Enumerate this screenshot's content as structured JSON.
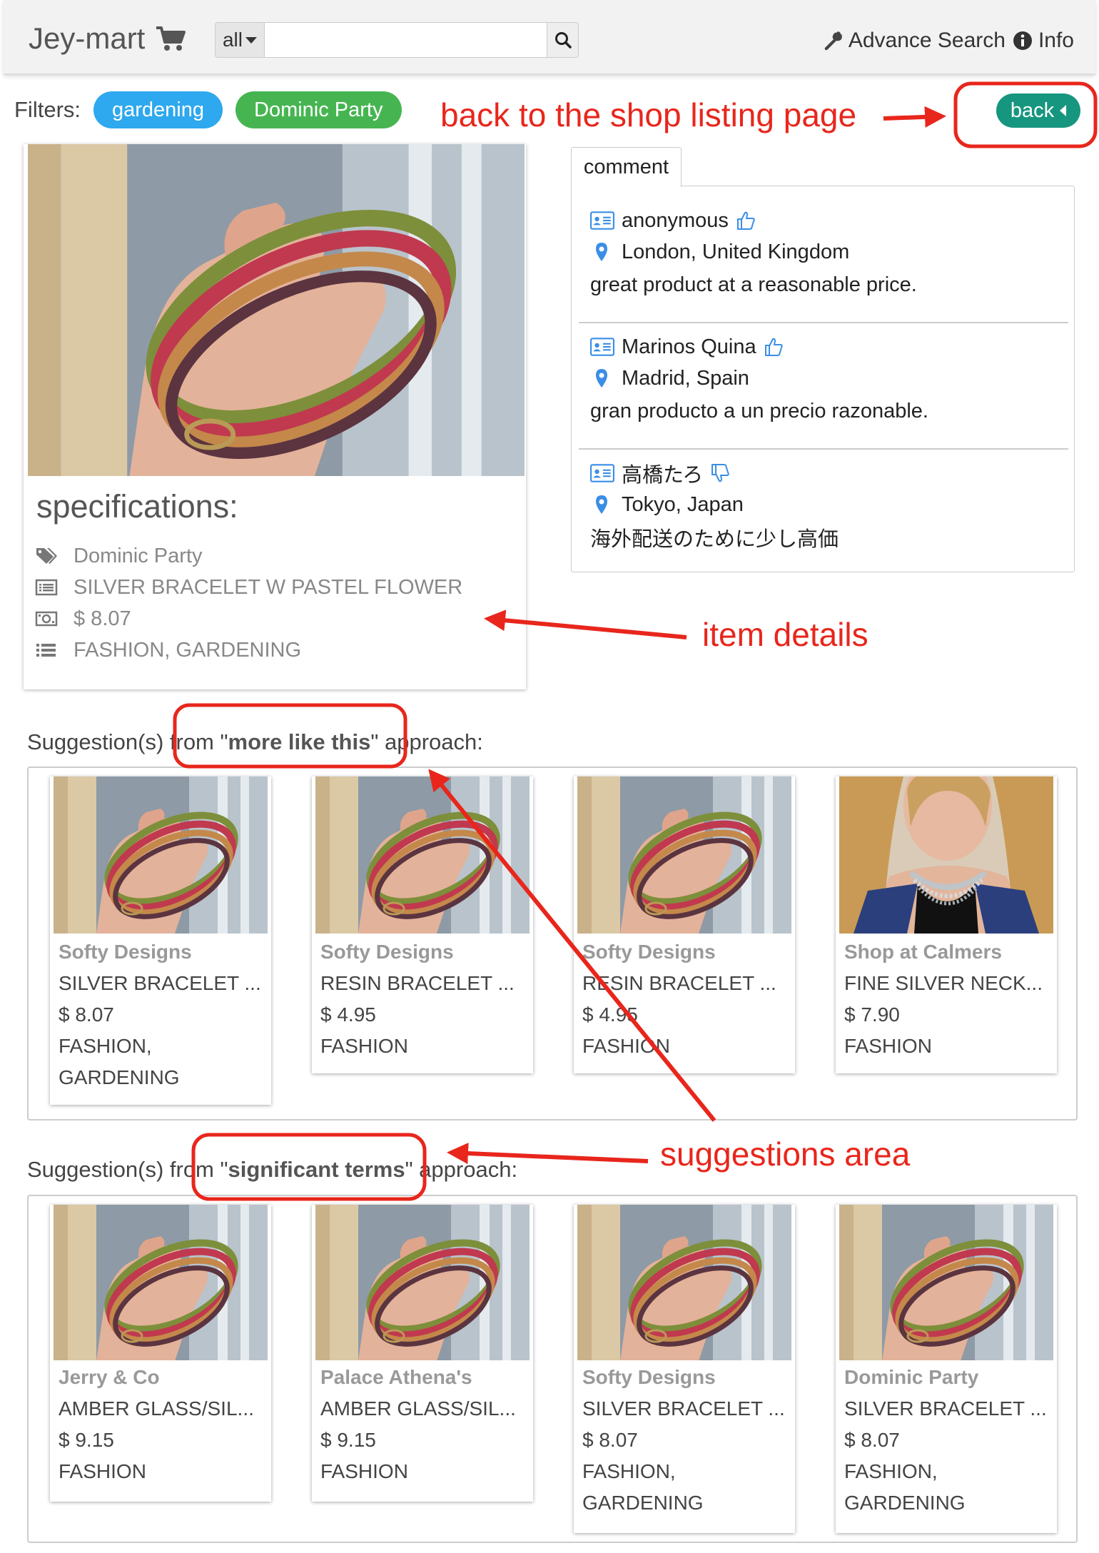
{
  "navbar": {
    "brand": "Jey-mart",
    "search_scope": "all",
    "search_value": "",
    "advance_search": "Advance Search",
    "info": "Info"
  },
  "filters": {
    "label": "Filters:",
    "chips": [
      "gardening",
      "Dominic Party"
    ]
  },
  "back_button": "back",
  "item": {
    "spec_title": "specifications:",
    "shop": "Dominic Party",
    "name": "SILVER BRACELET W PASTEL FLOWER",
    "price": "$ 8.07",
    "categories": "FASHION, GARDENING"
  },
  "comments": {
    "tab": "comment",
    "items": [
      {
        "name": "anonymous",
        "location": "London, United Kingdom",
        "text": "great product at a reasonable price.",
        "rating": "thumbs-up"
      },
      {
        "name": "Marinos Quina",
        "location": "Madrid, Spain",
        "text": "gran producto a un precio razonable.",
        "rating": "thumbs-up"
      },
      {
        "name": "高橋たろ",
        "location": "Tokyo, Japan",
        "text": "海外配送のために少し高価",
        "rating": "thumbs-down"
      }
    ]
  },
  "suggestions_mlt": {
    "prefix": "Suggestion(s) from \"",
    "term": "more like this",
    "suffix": "\" approach:",
    "products": [
      {
        "shop": "Softy Designs",
        "title": "SILVER BRACELET ...",
        "price": "$ 8.07",
        "category": "FASHION, GARDENING",
        "image": "bracelet"
      },
      {
        "shop": "Softy Designs",
        "title": "RESIN BRACELET ...",
        "price": "$ 4.95",
        "category": "FASHION",
        "image": "bracelet"
      },
      {
        "shop": "Softy Designs",
        "title": "RESIN BRACELET ...",
        "price": "$ 4.95",
        "category": "FASHION",
        "image": "bracelet"
      },
      {
        "shop": "Shop at Calmers",
        "title": "FINE SILVER NECK...",
        "price": "$ 7.90",
        "category": "FASHION",
        "image": "necklace"
      }
    ]
  },
  "suggestions_sig": {
    "prefix": "Suggestion(s) from \"",
    "term": "significant terms",
    "suffix": "\" approach:",
    "products": [
      {
        "shop": "Jerry & Co",
        "title": "AMBER GLASS/SIL...",
        "price": "$ 9.15",
        "category": "FASHION",
        "image": "bracelet"
      },
      {
        "shop": "Palace Athena's",
        "title": "AMBER GLASS/SIL...",
        "price": "$ 9.15",
        "category": "FASHION",
        "image": "bracelet"
      },
      {
        "shop": "Softy Designs",
        "title": "SILVER BRACELET ...",
        "price": "$ 8.07",
        "category": "FASHION, GARDENING",
        "image": "bracelet"
      },
      {
        "shop": "Dominic Party",
        "title": "SILVER BRACELET ...",
        "price": "$ 8.07",
        "category": "FASHION, GARDENING",
        "image": "bracelet"
      }
    ]
  },
  "annotations": {
    "back": "back to the shop listing page",
    "details": "item details",
    "suggestions": "suggestions area"
  },
  "colors": {
    "accent_red": "#e8261c",
    "chip_blue": "#2ea8ee",
    "chip_green": "#46b551",
    "back_teal": "#17967f",
    "icon_blue": "#3a8ee6"
  }
}
